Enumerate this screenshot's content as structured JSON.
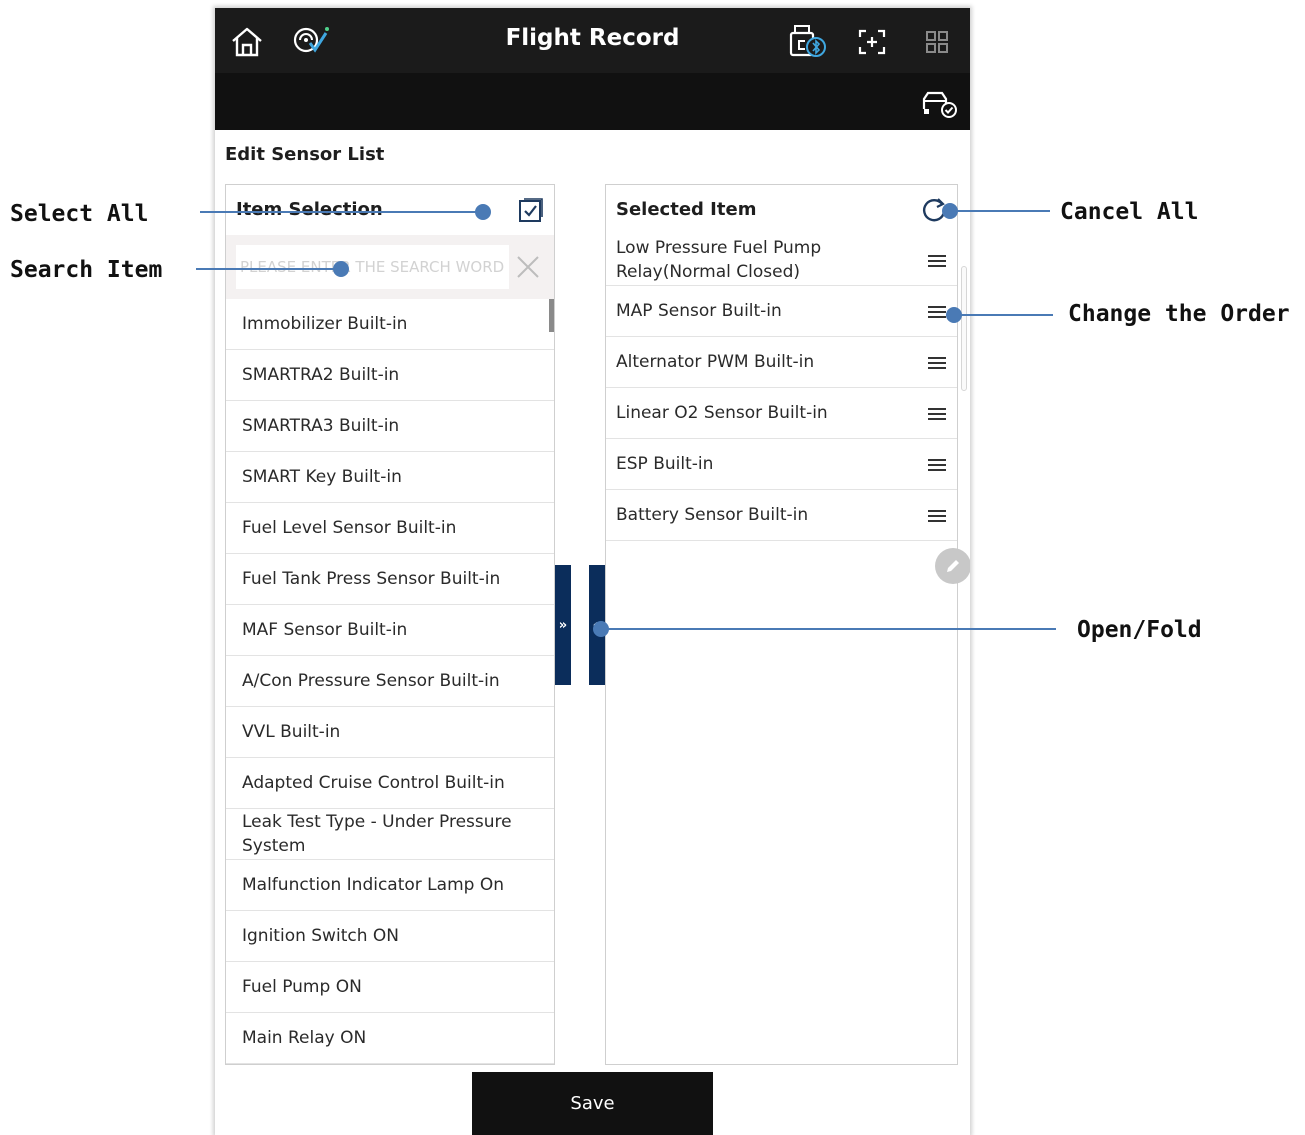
{
  "header": {
    "title": "Flight Record",
    "icons": [
      "home-icon",
      "vehicle-scan-icon",
      "vci-bluetooth-icon",
      "screen-capture-icon",
      "grid-menu-icon",
      "car-check-icon"
    ]
  },
  "editor": {
    "title": "Edit Sensor List",
    "left_panel": {
      "header": "Item Selection",
      "search_placeholder": "PLEASE ENTER THE SEARCH WORD",
      "items": [
        "Immobilizer Built-in",
        "SMARTRA2 Built-in",
        "SMARTRA3 Built-in",
        "SMART Key Built-in",
        "Fuel Level Sensor Built-in",
        "Fuel Tank Press Sensor Built-in",
        "MAF Sensor Built-in",
        "A/Con Pressure Sensor Built-in",
        "VVL Built-in",
        "Adapted Cruise Control Built-in",
        "Leak Test Type - Under Pressure System",
        "Malfunction Indicator Lamp On",
        "Ignition Switch ON",
        "Fuel Pump ON",
        "Main Relay ON"
      ]
    },
    "right_panel": {
      "header": "Selected Item",
      "items": [
        "Low Pressure Fuel Pump Relay(Normal Closed)",
        "MAP Sensor Built-in",
        "Alternator PWM Built-in",
        "Linear O2 Sensor Built-in",
        "ESP Built-in",
        "Battery Sensor Built-in"
      ]
    },
    "fold_open_glyph": "»",
    "fold_close_glyph": "«",
    "save_label": "Save"
  },
  "annotations": {
    "select_all": "Select All",
    "search_item": "Search Item",
    "cancel_all": "Cancel All",
    "change_order": "Change the Order",
    "open_fold": "Open/Fold",
    "line_color": "#4a7ab5"
  },
  "colors": {
    "topbar": "#1b1b1b",
    "fold_tab": "#0b2d5b",
    "save_button": "#111111"
  }
}
